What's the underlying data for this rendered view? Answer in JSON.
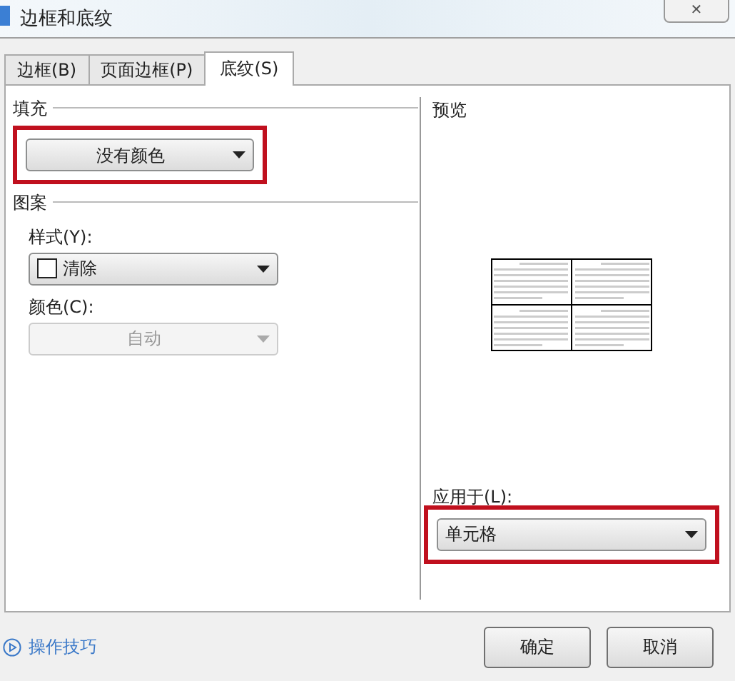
{
  "window": {
    "title": "边框和底纹",
    "close": "✕"
  },
  "tabs": [
    {
      "label": "边框(B)",
      "selected": false
    },
    {
      "label": "页面边框(P)",
      "selected": false
    },
    {
      "label": "底纹(S)",
      "selected": true
    }
  ],
  "fill": {
    "heading": "填充",
    "dropdown": {
      "value": "没有颜色",
      "highlighted": true
    }
  },
  "pattern": {
    "heading": "图案",
    "style_label": "样式(Y):",
    "style": {
      "value": "清除",
      "disabled": false
    },
    "color_label": "颜色(C):",
    "color": {
      "value": "自动",
      "disabled": true
    }
  },
  "preview": {
    "heading": "预览",
    "apply_label": "应用于(L):",
    "apply": {
      "value": "单元格",
      "highlighted": true
    }
  },
  "footer": {
    "tips_link": "操作技巧",
    "buttons": [
      "确定",
      "取消"
    ]
  }
}
